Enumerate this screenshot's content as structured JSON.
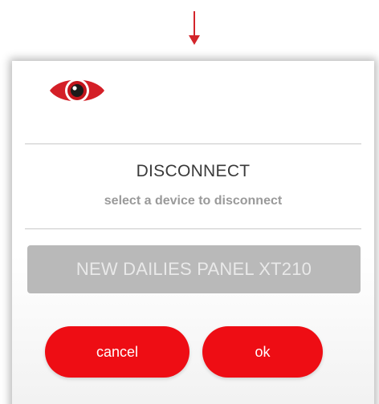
{
  "dialog": {
    "title": "DISCONNECT",
    "subtitle": "select a device to disconnect",
    "device_label": "NEW DAILIES PANEL XT210",
    "cancel_label": "cancel",
    "ok_label": "ok"
  },
  "icons": {
    "arrow": "arrow-down-icon",
    "logo": "eye-icon"
  },
  "colors": {
    "accent": "#ee0d14",
    "device_bg": "#b9b9b9",
    "device_text": "#e9e9e9"
  }
}
